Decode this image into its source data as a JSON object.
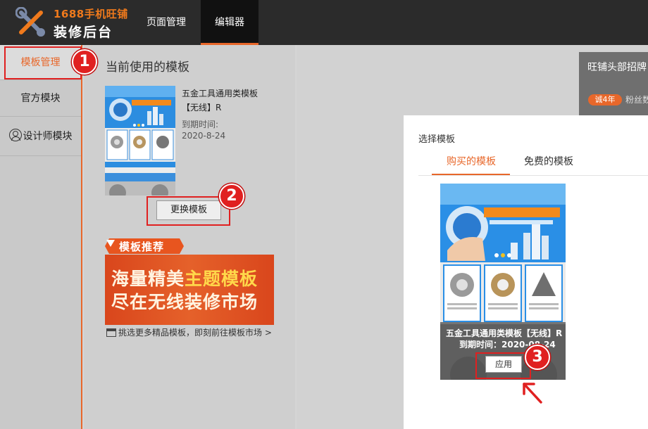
{
  "header": {
    "logo_top": "1688手机旺铺",
    "logo_bottom": "装修后台",
    "nav": {
      "page_management": "页面管理",
      "editor": "编辑器"
    }
  },
  "sidebar": {
    "items": [
      {
        "label": "模板管理"
      },
      {
        "label": "官方模块"
      },
      {
        "label": "设计师模块"
      }
    ]
  },
  "current": {
    "title": "当前使用的模板",
    "template_name": "五金工具通用类模板【无线】R",
    "expire_label": "到期时间:",
    "expire_value": "2020-8-24",
    "change_button": "更换模板"
  },
  "recommend": {
    "tag": "模板推荐",
    "banner_line1_a": "海量精美",
    "banner_line1_b": "主题模板",
    "banner_line2": "尽在无线装修市场",
    "market_link": "挑选更多精品模板，即刻前往模板市场 >"
  },
  "bg_card": {
    "title": "旺铺头部招牌",
    "years_badge": "诚4年",
    "fans": "粉丝数"
  },
  "dialog": {
    "title": "选择模板",
    "tabs": [
      "购买的模板",
      "免费的模板"
    ],
    "template_name": "五金工具通用类模板【无线】R",
    "expire": "到期时间：2020-08-24",
    "apply_button": "应用"
  },
  "markers": [
    "1",
    "2",
    "3"
  ],
  "colors": {
    "accent": "#e8672a",
    "header_bg": "#2b2b2b",
    "highlight": "#e02020"
  }
}
